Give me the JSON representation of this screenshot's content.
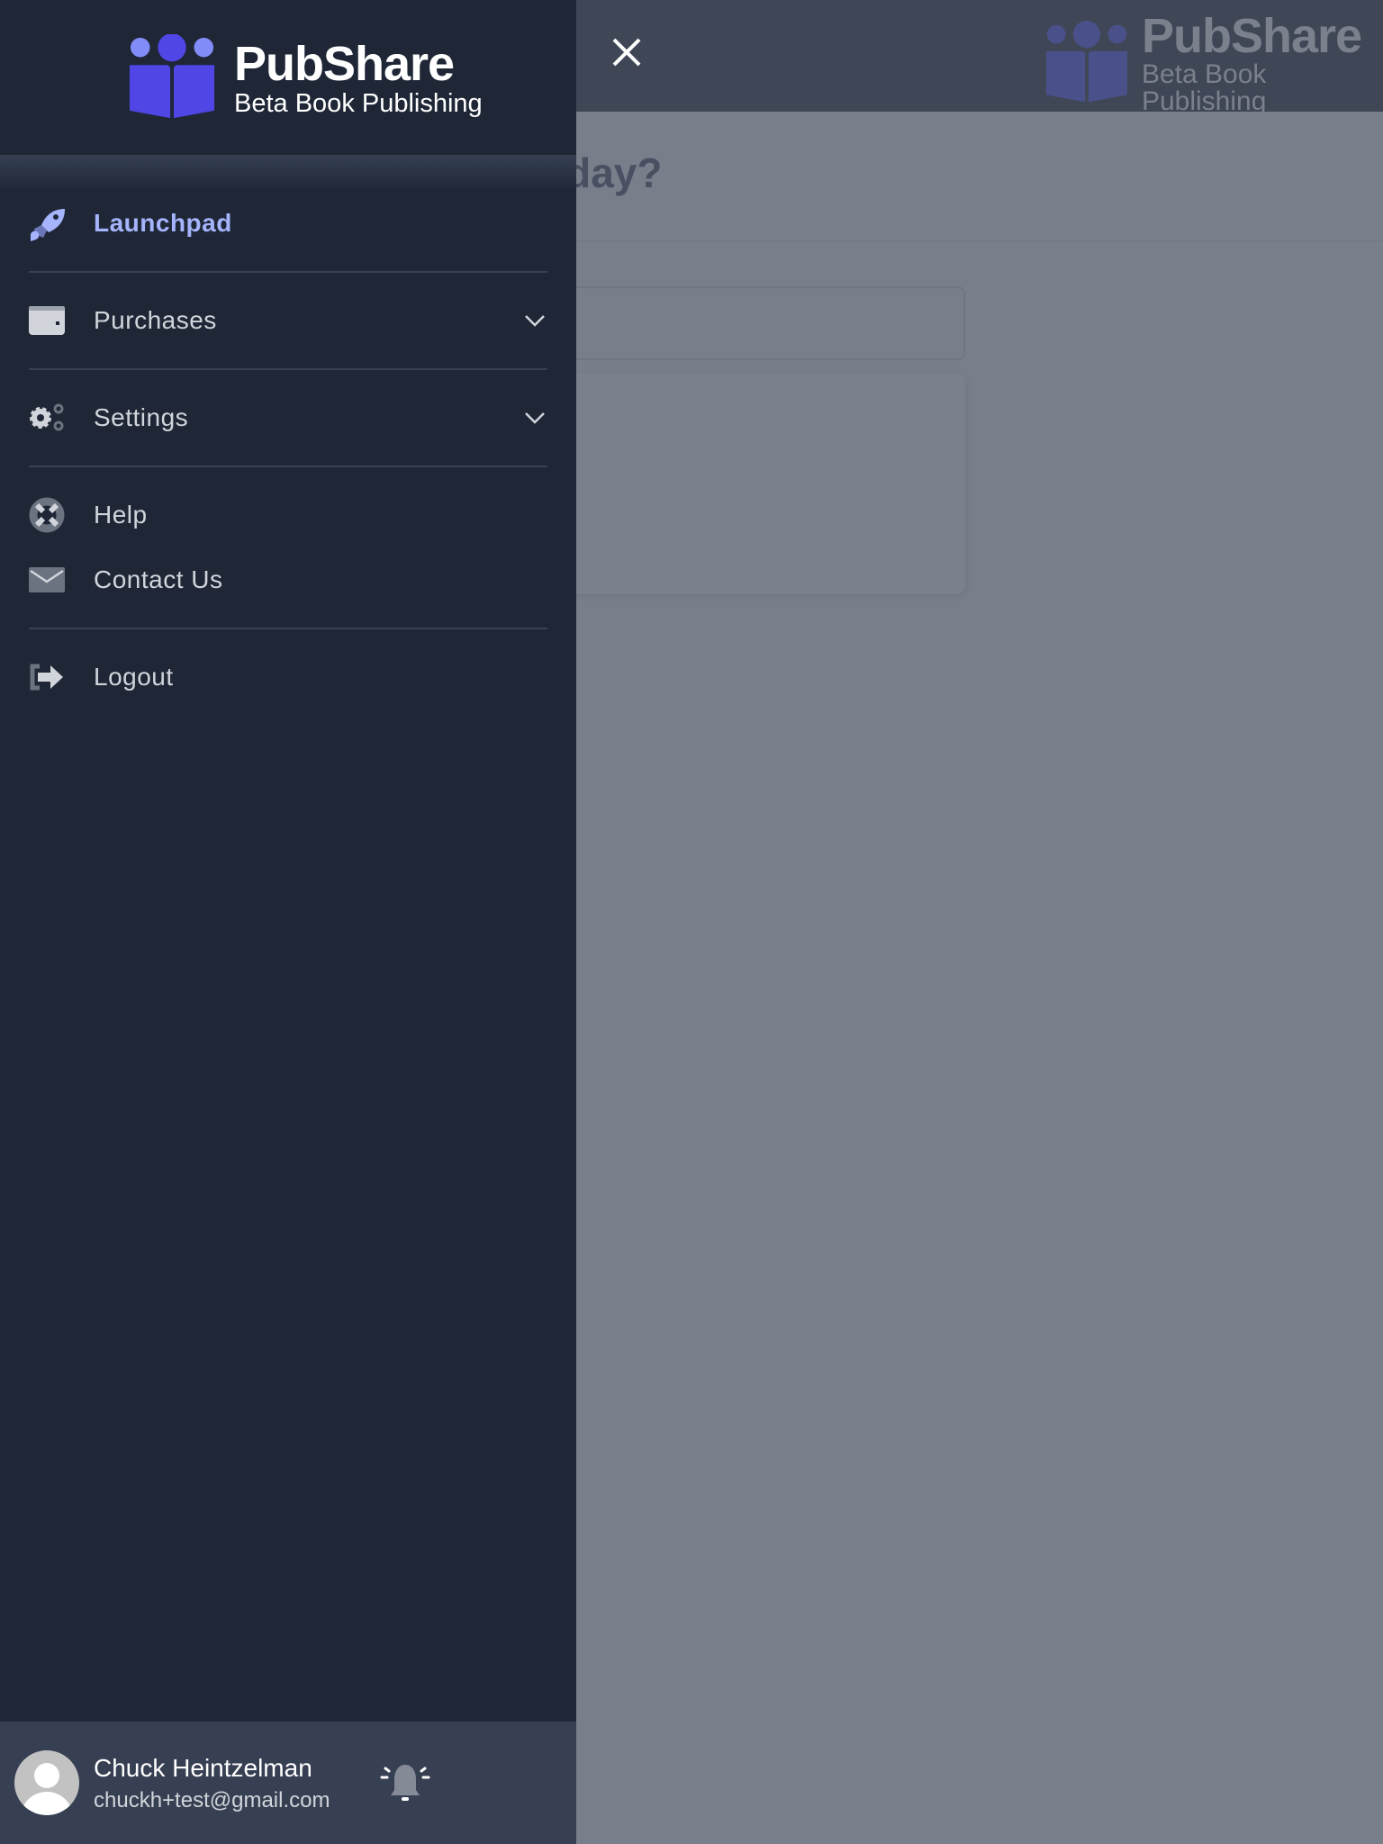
{
  "brand": {
    "name": "PubShare",
    "tagline": "Beta Book Publishing",
    "color": "#4f46e5"
  },
  "background": {
    "heading_fragment": "oday?"
  },
  "nav": {
    "items": [
      {
        "label": "Launchpad",
        "icon": "rocket-icon",
        "active": true
      },
      {
        "label": "Purchases",
        "icon": "wallet-icon",
        "expandable": true
      },
      {
        "label": "Settings",
        "icon": "gears-icon",
        "expandable": true
      },
      {
        "label": "Help",
        "icon": "life-ring-icon"
      },
      {
        "label": "Contact Us",
        "icon": "envelope-icon"
      },
      {
        "label": "Logout",
        "icon": "logout-icon"
      }
    ]
  },
  "user": {
    "name": "Chuck Heintzelman",
    "email": "chuckh+test@gmail.com"
  },
  "colors": {
    "sidebar": "#1f2737",
    "active": "#a5b4fc",
    "overlay": "#787e8a"
  }
}
